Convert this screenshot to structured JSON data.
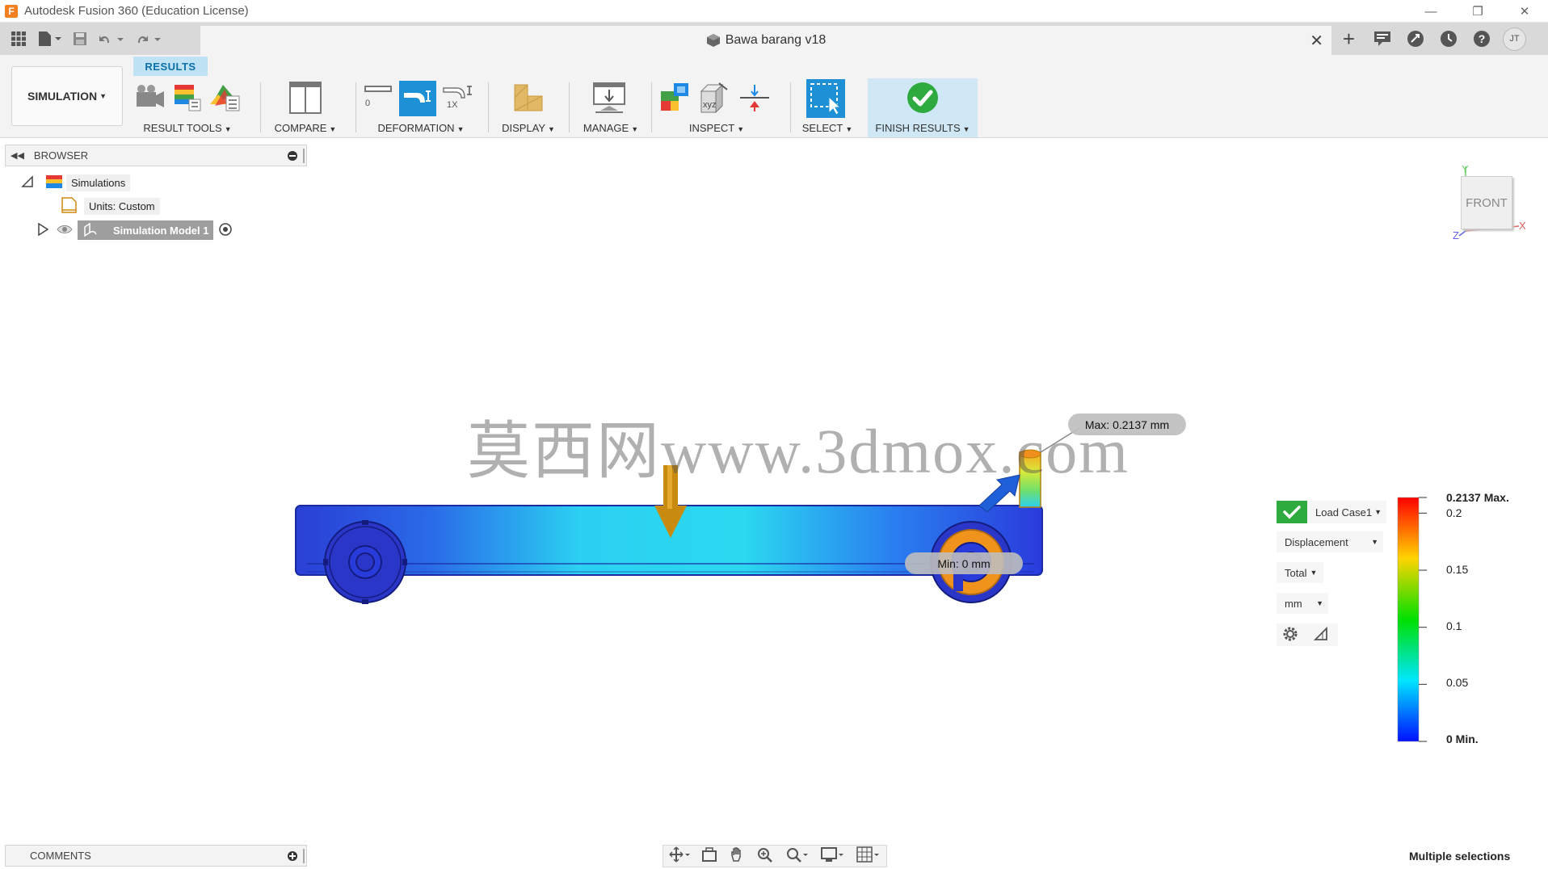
{
  "window": {
    "app_title": "Autodesk Fusion 360 (Education License)",
    "controls": [
      "—",
      "❐",
      "✕"
    ]
  },
  "quick_access": {
    "icons": [
      "grid-icon",
      "file-icon",
      "save-icon",
      "undo-icon",
      "redo-icon"
    ]
  },
  "document": {
    "tab_title": "Bawa barang v18",
    "close_glyph": "✕"
  },
  "right_icons": {
    "add": "+",
    "avatar_initials": "JT"
  },
  "ribbon": {
    "workspace_label": "SIMULATION",
    "active_tab": "RESULTS",
    "groups": {
      "result_tools": "RESULT TOOLS",
      "compare": "COMPARE",
      "deformation": "DEFORMATION",
      "display": "DISPLAY",
      "manage": "MANAGE",
      "inspect": "INSPECT",
      "select": "SELECT",
      "finish_results": "FINISH RESULTS"
    },
    "deformation_scale_labels": [
      "0",
      "1X"
    ],
    "inspect_xyz": "xyz"
  },
  "browser": {
    "title": "BROWSER",
    "tree": {
      "simulations": "Simulations",
      "units": "Units: Custom",
      "model": "Simulation Model 1"
    }
  },
  "viewport": {
    "viewcube_face": "FRONT",
    "axes": {
      "y": "Y",
      "x": "X",
      "z": "Z"
    },
    "watermark": "莫西网www.3dmox.com",
    "max_probe": "Max: 0.2137 mm",
    "min_probe": "Min: 0 mm"
  },
  "legend": {
    "load_case": "Load Case1",
    "result_type": "Displacement",
    "component": "Total",
    "units": "mm",
    "max_value": 0.2137,
    "min_value": 0,
    "ticks": [
      {
        "label": "0.2137 Max.",
        "value": 0.2137
      },
      {
        "label": "0.2",
        "value": 0.2
      },
      {
        "label": "0.15",
        "value": 0.15
      },
      {
        "label": "0.1",
        "value": 0.1
      },
      {
        "label": "0.05",
        "value": 0.05
      },
      {
        "label": "0 Min.",
        "value": 0
      }
    ],
    "colors": [
      "#ff0000",
      "#ffd400",
      "#00e000",
      "#00e6ff",
      "#0010ff"
    ]
  },
  "bottom": {
    "comments_title": "COMMENTS",
    "status": "Multiple selections"
  }
}
